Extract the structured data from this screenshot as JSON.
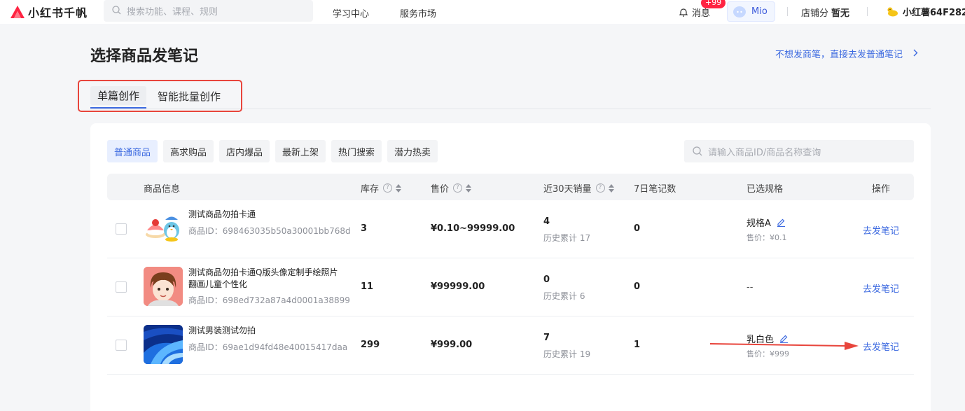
{
  "app": {
    "name": "小红书千帆",
    "brand_color": "#ff2442"
  },
  "top_search": {
    "placeholder": "搜索功能、课程、规则",
    "icon": "search-icon"
  },
  "nav": {
    "learning": "学习中心",
    "services": "服务市场"
  },
  "header": {
    "messages_label": "消息",
    "messages_badge": "+99",
    "mio_label": "Mio",
    "shop_score_label": "店铺分",
    "shop_score_value": "暂无",
    "user_name": "小红薯64F282"
  },
  "page": {
    "title": "选择商品发笔记",
    "plain_note_link": "不想发商笔，直接去发普通笔记"
  },
  "tabs": [
    {
      "label": "单篇创作",
      "active": true
    },
    {
      "label": "智能批量创作",
      "active": false
    }
  ],
  "filters": [
    {
      "label": "普通商品",
      "active": true
    },
    {
      "label": "高求购品",
      "active": false
    },
    {
      "label": "店内爆品",
      "active": false
    },
    {
      "label": "最新上架",
      "active": false
    },
    {
      "label": "热门搜索",
      "active": false
    },
    {
      "label": "潜力热卖",
      "active": false
    }
  ],
  "goods_search": {
    "placeholder": "请输入商品ID/商品名称查询"
  },
  "table": {
    "columns": {
      "info": "商品信息",
      "stock": "库存",
      "price": "售价",
      "sales30": "近30天销量",
      "notes7": "7日笔记数",
      "spec": "已选规格",
      "action": "操作"
    },
    "rows": [
      {
        "name": "测试商品勿拍卡通",
        "id": "商品ID：698463035b50a30001bb768d",
        "stock": "3",
        "price": "¥0.10~99999.00",
        "sales30": "4",
        "history": "历史累计 17",
        "notes7": "0",
        "spec": "规格A",
        "spec_price": "售价：¥0.1",
        "action": "去发笔记"
      },
      {
        "name": "测试商品勿拍卡通Q版头像定制手绘照片翻画儿童个性化",
        "id": "商品ID：698ed732a87a4d0001a38899",
        "stock": "11",
        "price": "¥99999.00",
        "sales30": "0",
        "history": "历史累计 6",
        "notes7": "0",
        "spec": "--",
        "action": "去发笔记"
      },
      {
        "name": "测试男装测试勿拍",
        "id": "商品ID：69ae1d94fd48e40015417daa",
        "stock": "299",
        "price": "¥999.00",
        "sales30": "7",
        "history": "历史累计 19",
        "notes7": "1",
        "spec": "乳白色",
        "spec_price": "售价：¥999",
        "action": "去发笔记"
      }
    ]
  }
}
